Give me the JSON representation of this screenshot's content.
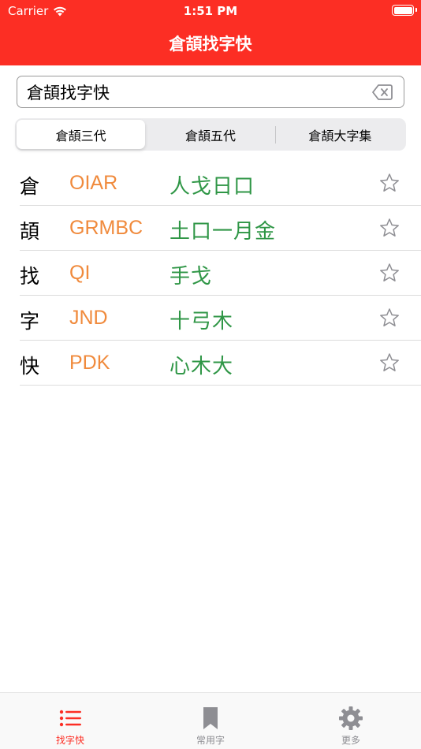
{
  "status_bar": {
    "carrier": "Carrier",
    "time": "1:51 PM"
  },
  "nav": {
    "title": "倉頡找字快"
  },
  "search": {
    "value": "倉頡找字快",
    "clear_icon": "delete-backspace-icon"
  },
  "segments": [
    {
      "label": "倉頡三代",
      "selected": true
    },
    {
      "label": "倉頡五代",
      "selected": false
    },
    {
      "label": "倉頡大字集",
      "selected": false
    }
  ],
  "results": [
    {
      "char": "倉",
      "code": "OIAR",
      "radicals": "人戈日口"
    },
    {
      "char": "頡",
      "code": "GRMBC",
      "radicals": "土口一月金"
    },
    {
      "char": "找",
      "code": "QI",
      "radicals": "手戈"
    },
    {
      "char": "字",
      "code": "JND",
      "radicals": "十弓木"
    },
    {
      "char": "快",
      "code": "PDK",
      "radicals": "心木大"
    }
  ],
  "tabs": [
    {
      "label": "找字快",
      "icon": "list-icon",
      "active": true
    },
    {
      "label": "常用字",
      "icon": "bookmark-icon",
      "active": false
    },
    {
      "label": "更多",
      "icon": "gear-icon",
      "active": false
    }
  ],
  "colors": {
    "accent": "#fc2e24",
    "code": "#f08a3c",
    "radicals": "#2f9646",
    "inactive": "#8e8e93"
  }
}
